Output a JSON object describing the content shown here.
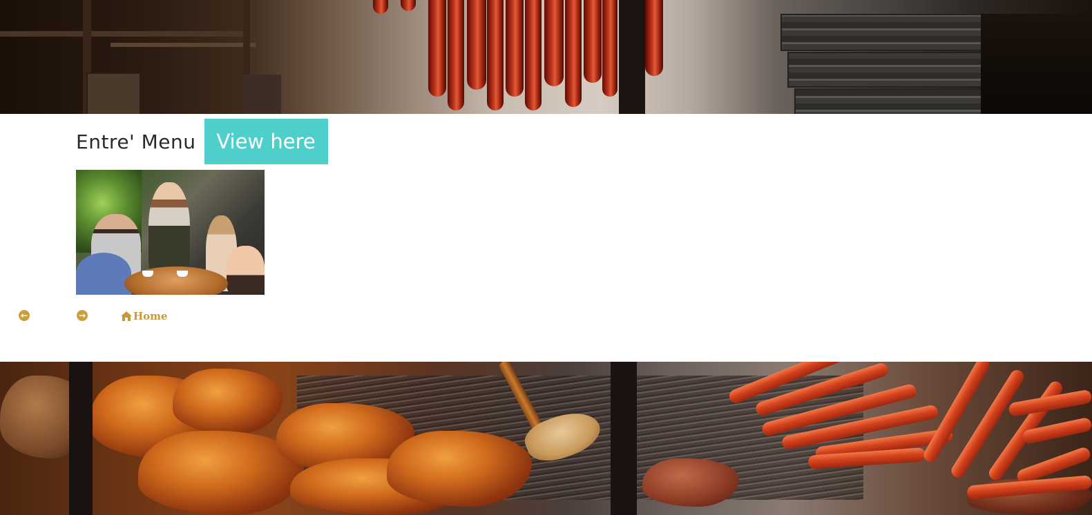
{
  "banners": {
    "top_image": "sausages-smokehouse-banner",
    "bottom_image": "bbq-grill-banner"
  },
  "menu": {
    "title": "Entre' Menu",
    "button_label": "View here",
    "button_color": "#4ecfcb"
  },
  "photo": {
    "subject": "waitress-taking-order-photo"
  },
  "nav": {
    "prev_icon": "arrow-circle-left-icon",
    "next_icon": "arrow-circle-right-icon",
    "home_icon": "home-icon",
    "home_label": "Home",
    "accent_color": "#c49a3a"
  }
}
